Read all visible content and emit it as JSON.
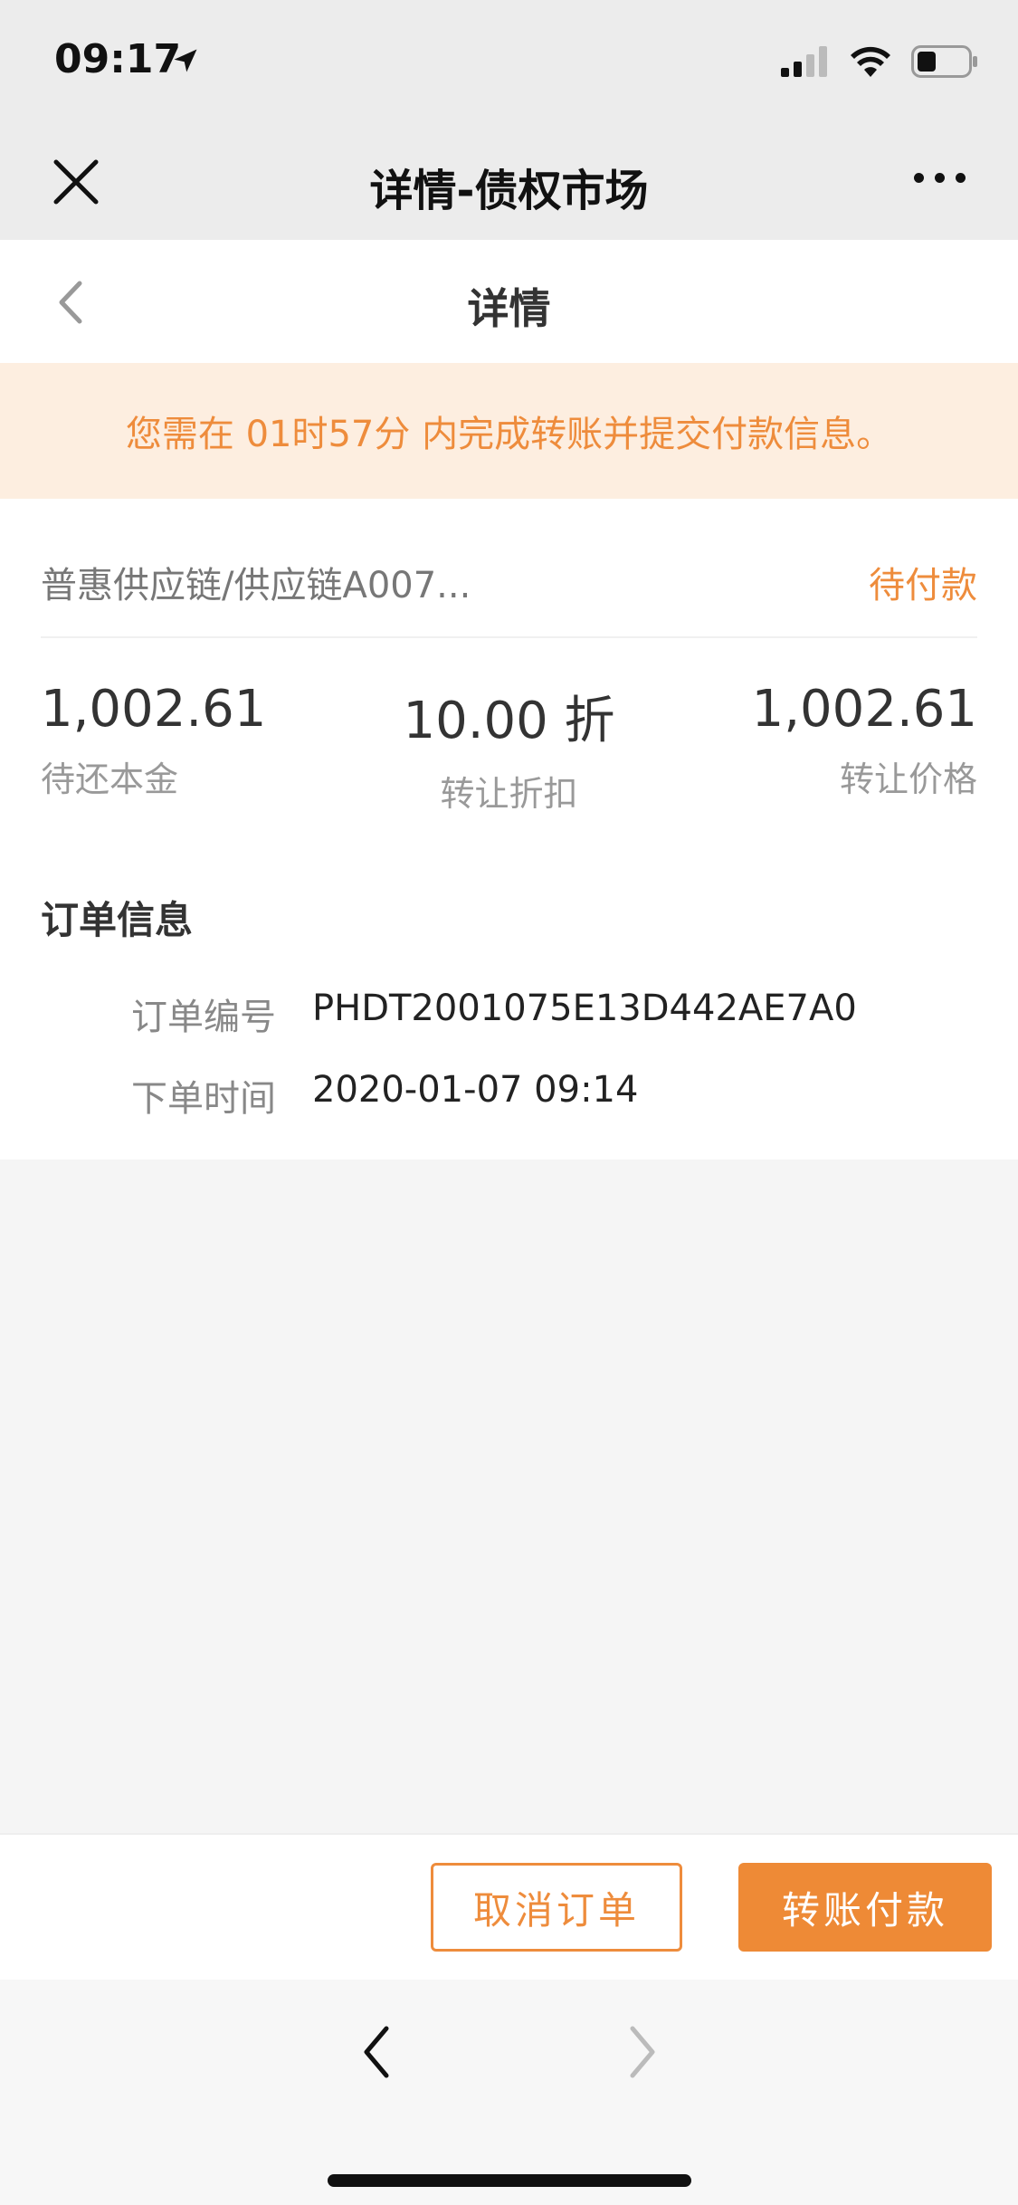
{
  "status_bar": {
    "time": "09:17",
    "icons": [
      "location-arrow-icon",
      "cellular-signal-icon",
      "wifi-icon",
      "battery-icon"
    ]
  },
  "wx_nav": {
    "title": "详情-债权市场",
    "close_icon": "close-icon",
    "more_icon": "more-dots-icon"
  },
  "page_header": {
    "title": "详情",
    "back_icon": "chevron-left-icon"
  },
  "notice": {
    "text": "您需在 01时57分 内完成转账并提交付款信息。"
  },
  "product": {
    "name": "普惠供应链/供应链A007...",
    "status": "待付款"
  },
  "stats": [
    {
      "value": "1,002.61",
      "label": "待还本金"
    },
    {
      "value": "10.00 折",
      "label": "转让折扣"
    },
    {
      "value": "1,002.61",
      "label": "转让价格"
    }
  ],
  "order": {
    "title": "订单信息",
    "rows": [
      {
        "label": "订单编号",
        "value": "PHDT2001075E13D442AE7A0"
      },
      {
        "label": "下单时间",
        "value": "2020-01-07 09:14"
      }
    ]
  },
  "actions": {
    "cancel_label": "取消订单",
    "pay_label": "转账付款"
  },
  "colors": {
    "accent": "#ee8c3c",
    "notice_bg": "#fdeee0"
  }
}
